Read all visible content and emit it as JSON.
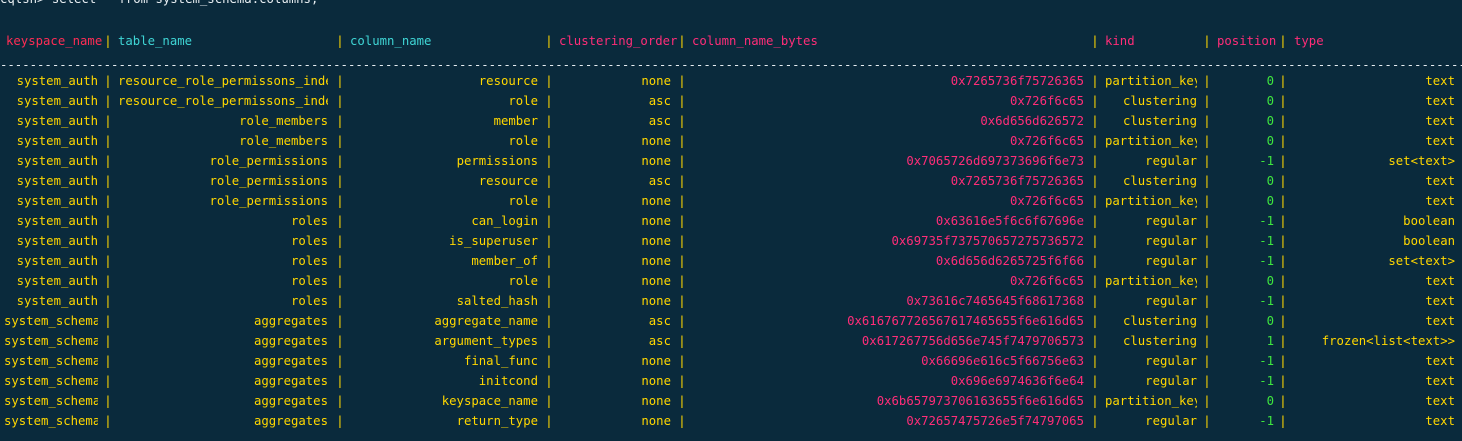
{
  "terminal": {
    "prompt": "cqlsh> select * from system_schema.columns;",
    "colors": {
      "background": "#0a2a3c",
      "keyspace_name_header": "#ff2d55",
      "table_name_header": "#3fd5d5",
      "column_name_header": "#3fd5d5",
      "clustering_order_header": "#ff2d78",
      "column_name_bytes_header": "#ff2d78",
      "kind_header": "#ff2d78",
      "position_header": "#ff2d78",
      "type_header": "#ff2d78",
      "text": "#ffd700",
      "bytes": "#ff2d78",
      "position_value": "#3ee63e"
    },
    "headers": {
      "keyspace_name": "keyspace_name",
      "table_name": "table_name",
      "column_name": "column_name",
      "clustering_order": "clustering_order",
      "column_name_bytes": "column_name_bytes",
      "kind": "kind",
      "position": "position",
      "type": "type"
    },
    "divider": "-------------------------------------------------------------------------------------------------------------------------------------------------------------------------------------------------------------------------------------------",
    "rows": [
      {
        "keyspace_name": "system_auth",
        "table_name": "resource_role_permissons_index",
        "column_name": "resource",
        "clustering_order": "none",
        "column_name_bytes": "0x7265736f75726365",
        "kind": "partition_key",
        "position": "0",
        "type": "text"
      },
      {
        "keyspace_name": "system_auth",
        "table_name": "resource_role_permissons_index",
        "column_name": "role",
        "clustering_order": "asc",
        "column_name_bytes": "0x726f6c65",
        "kind": "clustering",
        "position": "0",
        "type": "text"
      },
      {
        "keyspace_name": "system_auth",
        "table_name": "role_members",
        "column_name": "member",
        "clustering_order": "asc",
        "column_name_bytes": "0x6d656d626572",
        "kind": "clustering",
        "position": "0",
        "type": "text"
      },
      {
        "keyspace_name": "system_auth",
        "table_name": "role_members",
        "column_name": "role",
        "clustering_order": "none",
        "column_name_bytes": "0x726f6c65",
        "kind": "partition_key",
        "position": "0",
        "type": "text"
      },
      {
        "keyspace_name": "system_auth",
        "table_name": "role_permissions",
        "column_name": "permissions",
        "clustering_order": "none",
        "column_name_bytes": "0x7065726d697373696f6e73",
        "kind": "regular",
        "position": "-1",
        "type": "set<text>"
      },
      {
        "keyspace_name": "system_auth",
        "table_name": "role_permissions",
        "column_name": "resource",
        "clustering_order": "asc",
        "column_name_bytes": "0x7265736f75726365",
        "kind": "clustering",
        "position": "0",
        "type": "text"
      },
      {
        "keyspace_name": "system_auth",
        "table_name": "role_permissions",
        "column_name": "role",
        "clustering_order": "none",
        "column_name_bytes": "0x726f6c65",
        "kind": "partition_key",
        "position": "0",
        "type": "text"
      },
      {
        "keyspace_name": "system_auth",
        "table_name": "roles",
        "column_name": "can_login",
        "clustering_order": "none",
        "column_name_bytes": "0x63616e5f6c6f67696e",
        "kind": "regular",
        "position": "-1",
        "type": "boolean"
      },
      {
        "keyspace_name": "system_auth",
        "table_name": "roles",
        "column_name": "is_superuser",
        "clustering_order": "none",
        "column_name_bytes": "0x69735f737570657275736572",
        "kind": "regular",
        "position": "-1",
        "type": "boolean"
      },
      {
        "keyspace_name": "system_auth",
        "table_name": "roles",
        "column_name": "member_of",
        "clustering_order": "none",
        "column_name_bytes": "0x6d656d6265725f6f66",
        "kind": "regular",
        "position": "-1",
        "type": "set<text>"
      },
      {
        "keyspace_name": "system_auth",
        "table_name": "roles",
        "column_name": "role",
        "clustering_order": "none",
        "column_name_bytes": "0x726f6c65",
        "kind": "partition_key",
        "position": "0",
        "type": "text"
      },
      {
        "keyspace_name": "system_auth",
        "table_name": "roles",
        "column_name": "salted_hash",
        "clustering_order": "none",
        "column_name_bytes": "0x73616c7465645f68617368",
        "kind": "regular",
        "position": "-1",
        "type": "text"
      },
      {
        "keyspace_name": "system_schema",
        "table_name": "aggregates",
        "column_name": "aggregate_name",
        "clustering_order": "asc",
        "column_name_bytes": "0x616767726567617465655f6e616d65",
        "kind": "clustering",
        "position": "0",
        "type": "text"
      },
      {
        "keyspace_name": "system_schema",
        "table_name": "aggregates",
        "column_name": "argument_types",
        "clustering_order": "asc",
        "column_name_bytes": "0x617267756d656e745f7479706573",
        "kind": "clustering",
        "position": "1",
        "type": "frozen<list<text>>"
      },
      {
        "keyspace_name": "system_schema",
        "table_name": "aggregates",
        "column_name": "final_func",
        "clustering_order": "none",
        "column_name_bytes": "0x66696e616c5f66756e63",
        "kind": "regular",
        "position": "-1",
        "type": "text"
      },
      {
        "keyspace_name": "system_schema",
        "table_name": "aggregates",
        "column_name": "initcond",
        "clustering_order": "none",
        "column_name_bytes": "0x696e6974636f6e64",
        "kind": "regular",
        "position": "-1",
        "type": "text"
      },
      {
        "keyspace_name": "system_schema",
        "table_name": "aggregates",
        "column_name": "keyspace_name",
        "clustering_order": "none",
        "column_name_bytes": "0x6b657973706163655f6e616d65",
        "kind": "partition_key",
        "position": "0",
        "type": "text"
      },
      {
        "keyspace_name": "system_schema",
        "table_name": "aggregates",
        "column_name": "return_type",
        "clustering_order": "none",
        "column_name_bytes": "0x72657475726e5f74797065",
        "kind": "regular",
        "position": "-1",
        "type": "text"
      }
    ]
  }
}
